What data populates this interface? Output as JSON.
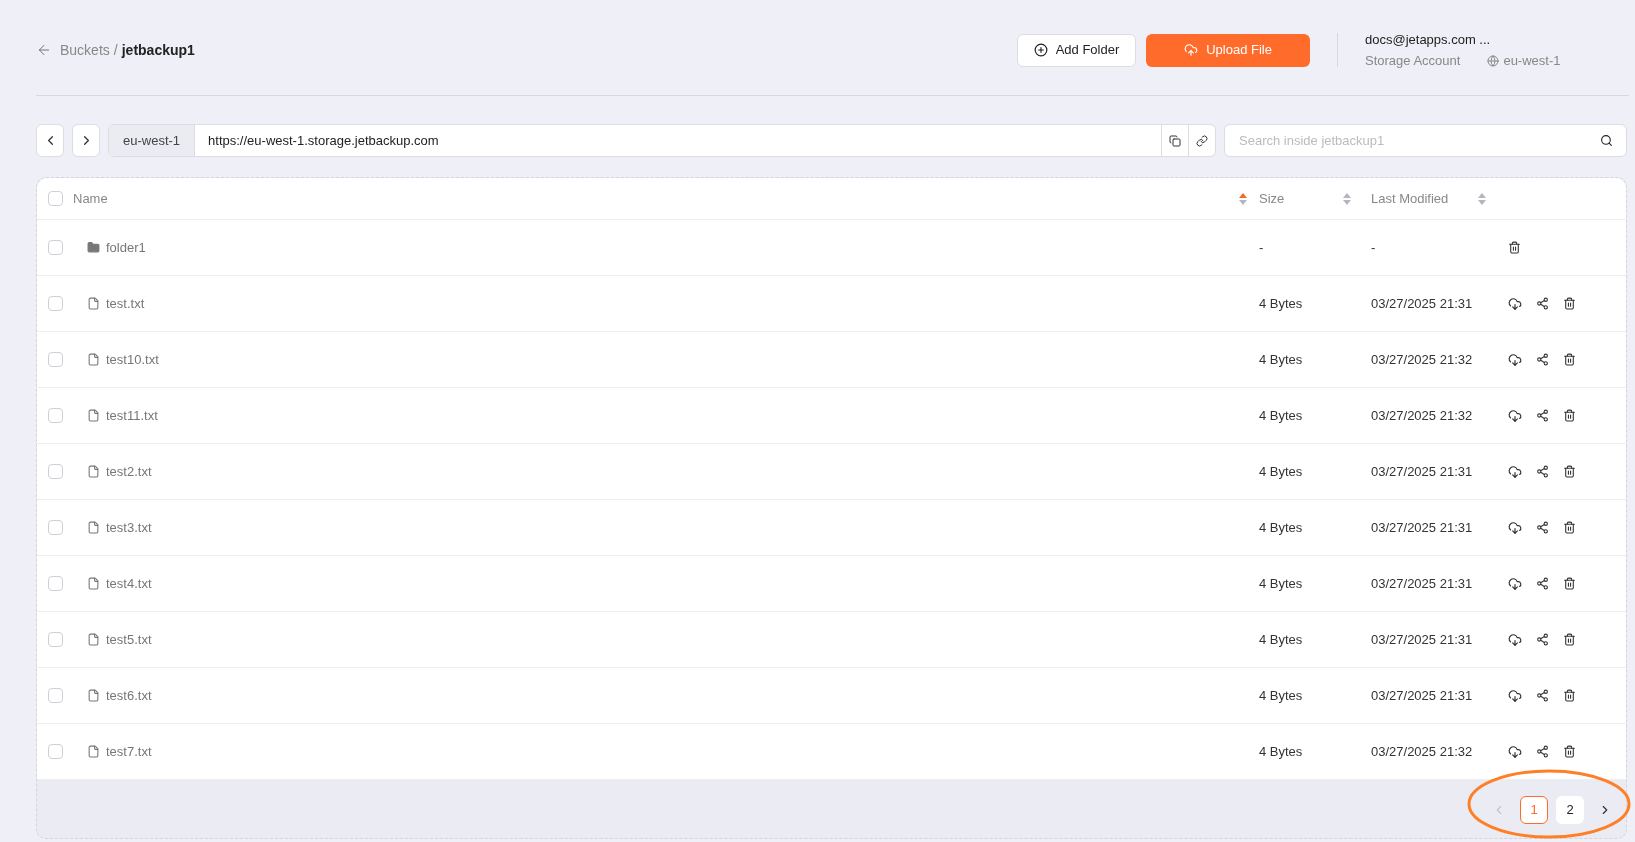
{
  "breadcrumb": {
    "parent": "Buckets",
    "separator": "/",
    "current": "jetbackup1"
  },
  "actions": [
    {
      "kind": "add-folder",
      "label": "Add Folder"
    },
    {
      "kind": "upload",
      "label": "Upload File"
    }
  ],
  "account": {
    "email": "docs@jetapps.com ...",
    "role": "Storage Account",
    "region": "eu-west-1"
  },
  "path_bar": {
    "region": "eu-west-1",
    "url": "https://eu-west-1.storage.jetbackup.com"
  },
  "search": {
    "placeholder": "Search inside jetbackup1"
  },
  "table": {
    "all_checked": false,
    "columns": [
      {
        "label": "Name",
        "sorted": true
      },
      {
        "label": "Size",
        "sorted": false
      },
      {
        "label": "Last Modified",
        "sorted": false
      }
    ],
    "rows": [
      {
        "kind": "folder",
        "name": "folder1",
        "size": "-",
        "modified": "-",
        "checked": false
      },
      {
        "kind": "file",
        "name": "test.txt",
        "size": "4 Bytes",
        "modified": "03/27/2025 21:31",
        "checked": false
      },
      {
        "kind": "file",
        "name": "test10.txt",
        "size": "4 Bytes",
        "modified": "03/27/2025 21:32",
        "checked": false
      },
      {
        "kind": "file",
        "name": "test11.txt",
        "size": "4 Bytes",
        "modified": "03/27/2025 21:32",
        "checked": false
      },
      {
        "kind": "file",
        "name": "test2.txt",
        "size": "4 Bytes",
        "modified": "03/27/2025 21:31",
        "checked": false
      },
      {
        "kind": "file",
        "name": "test3.txt",
        "size": "4 Bytes",
        "modified": "03/27/2025 21:31",
        "checked": false
      },
      {
        "kind": "file",
        "name": "test4.txt",
        "size": "4 Bytes",
        "modified": "03/27/2025 21:31",
        "checked": false
      },
      {
        "kind": "file",
        "name": "test5.txt",
        "size": "4 Bytes",
        "modified": "03/27/2025 21:31",
        "checked": false
      },
      {
        "kind": "file",
        "name": "test6.txt",
        "size": "4 Bytes",
        "modified": "03/27/2025 21:31",
        "checked": false
      },
      {
        "kind": "file",
        "name": "test7.txt",
        "size": "4 Bytes",
        "modified": "03/27/2025 21:32",
        "checked": false
      }
    ]
  },
  "pagination": {
    "prev_disabled": true,
    "pages": [
      {
        "label": "1",
        "selected": true
      },
      {
        "label": "2",
        "selected": false
      }
    ],
    "next_disabled": false
  }
}
